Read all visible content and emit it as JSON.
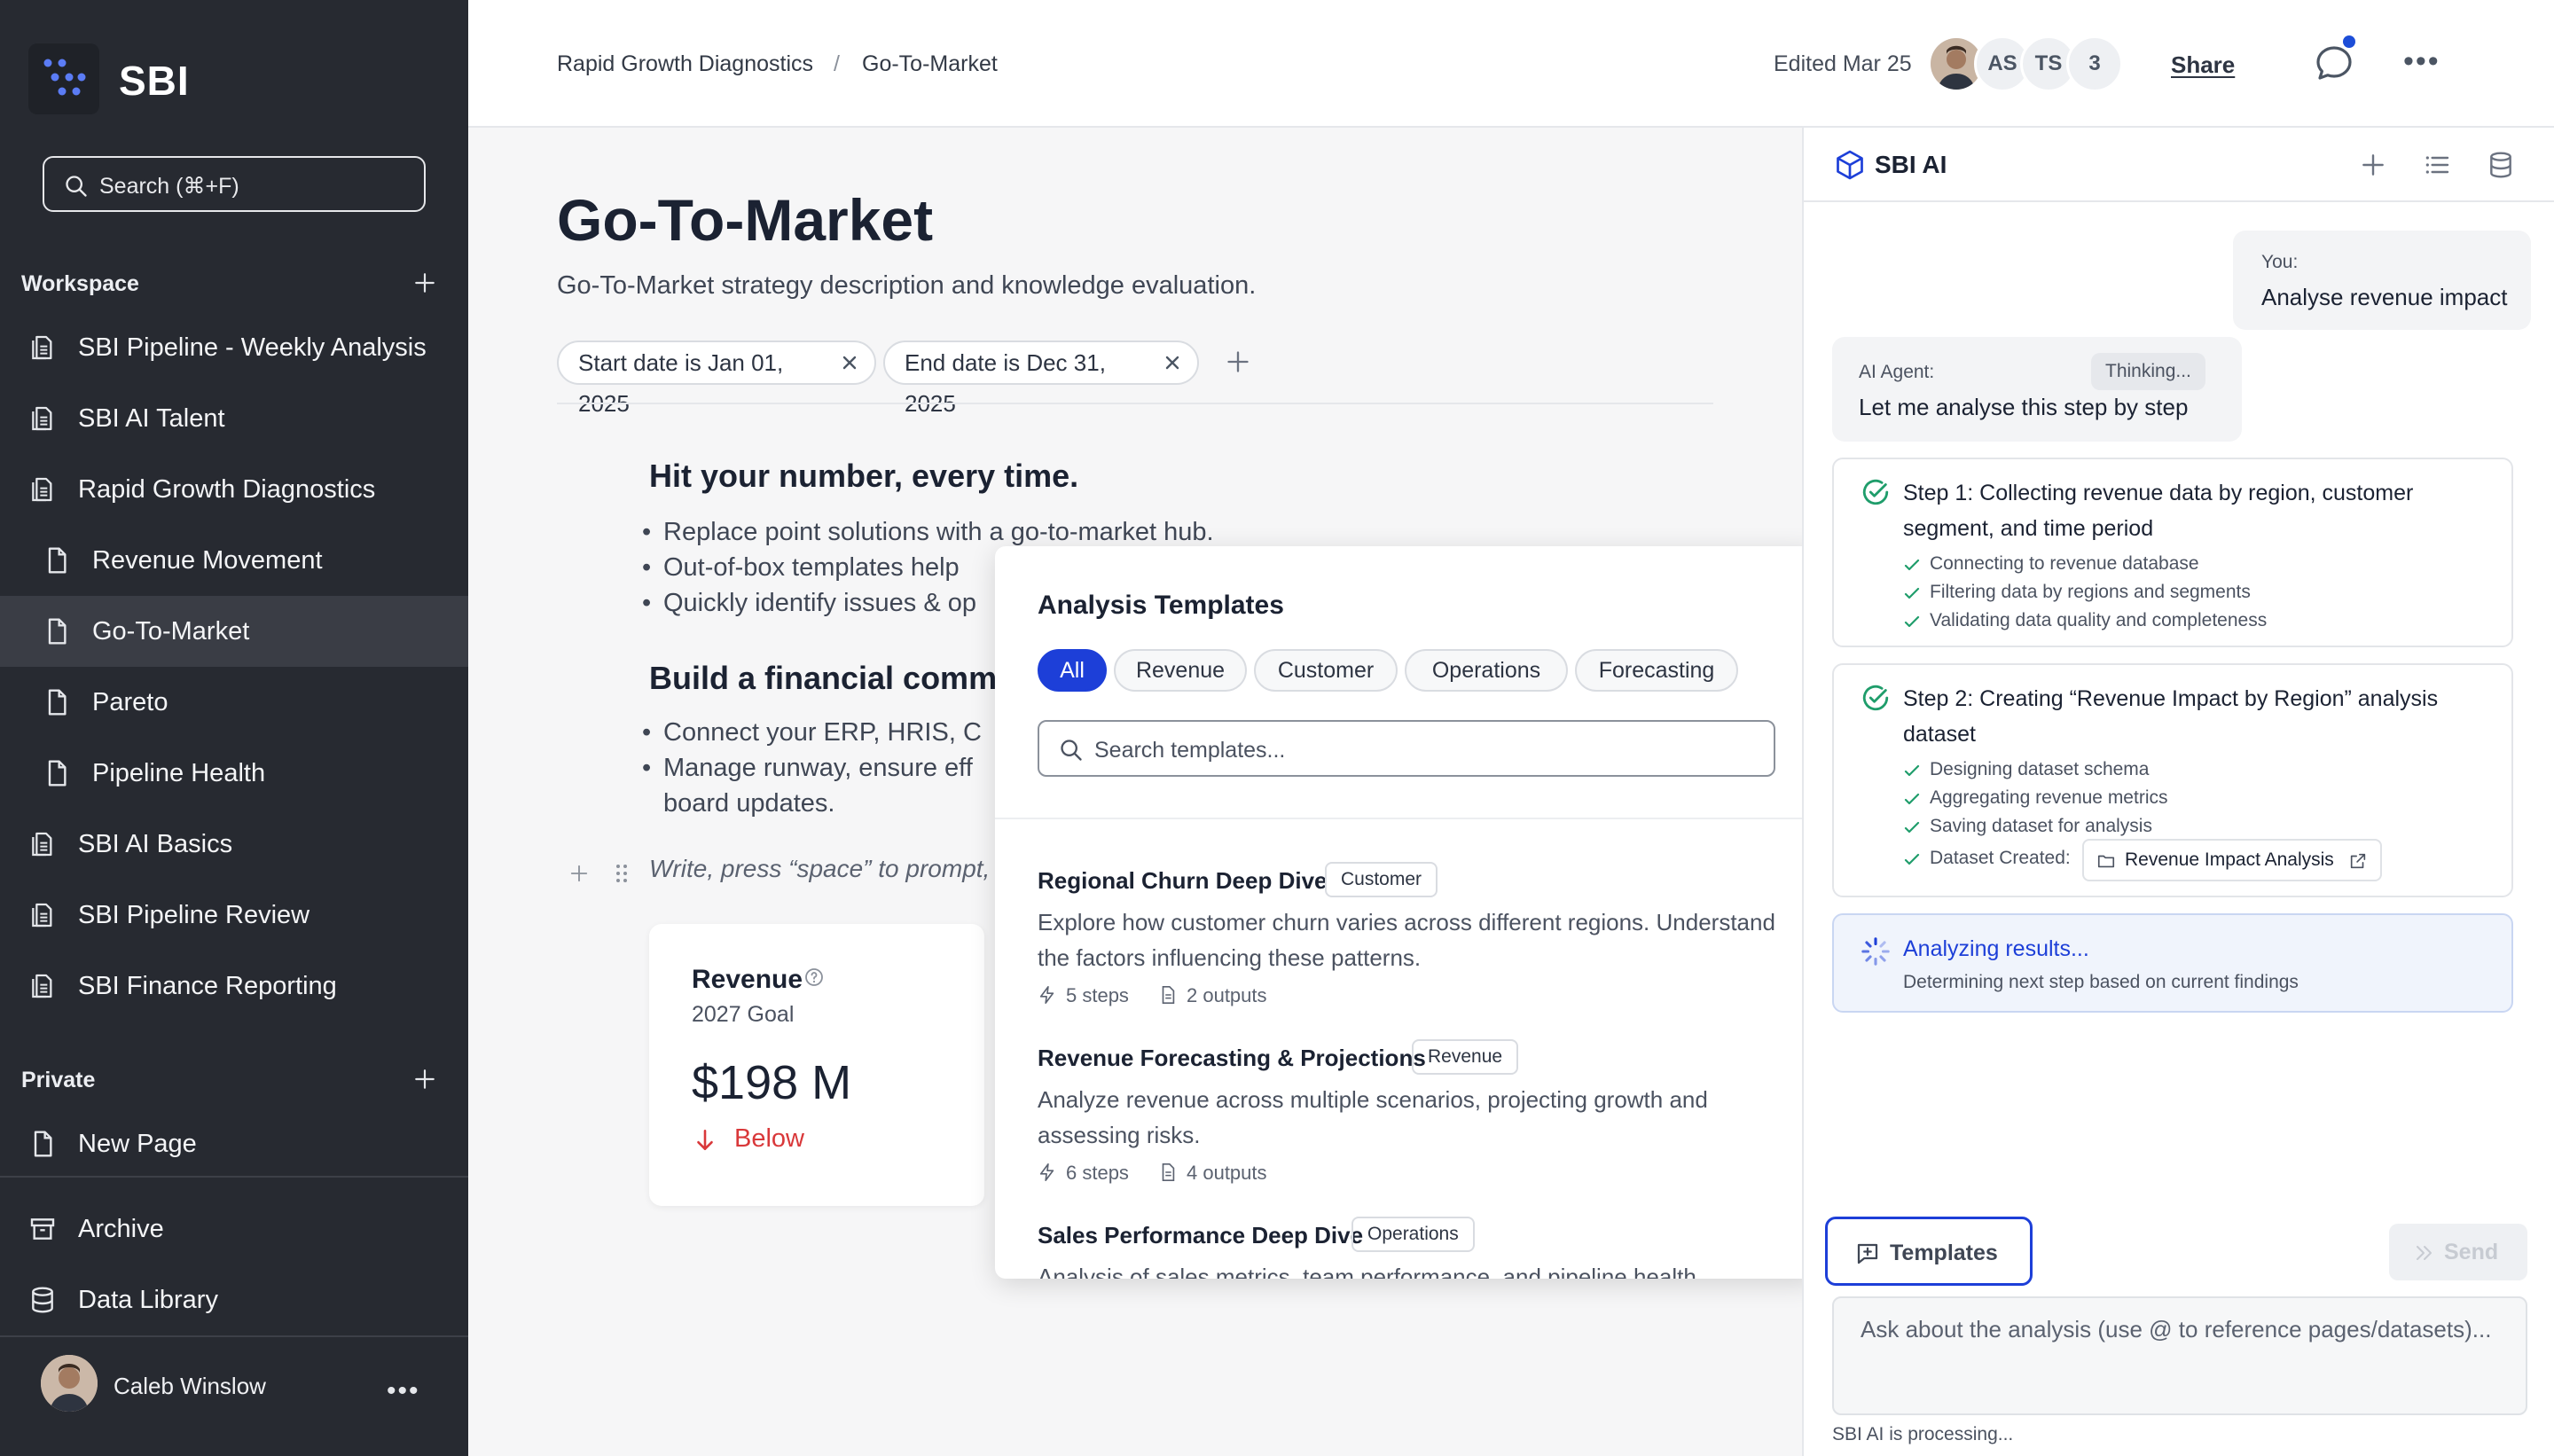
{
  "sidebar": {
    "brand": "SBI",
    "search_label": "Search (⌘+F)",
    "workspace_title": "Workspace",
    "workspace_items": [
      {
        "label": "SBI Pipeline - Weekly Analysis",
        "icon": "pages-icon"
      },
      {
        "label": "SBI AI Talent",
        "icon": "pages-icon"
      },
      {
        "label": "Rapid Growth Diagnostics",
        "icon": "pages-icon"
      },
      {
        "label": "Revenue Movement",
        "icon": "page-icon"
      },
      {
        "label": "Go-To-Market",
        "icon": "page-icon",
        "active": true
      },
      {
        "label": "Pareto",
        "icon": "page-icon"
      },
      {
        "label": "Pipeline Health",
        "icon": "page-icon"
      },
      {
        "label": "SBI AI Basics",
        "icon": "pages-icon"
      },
      {
        "label": "SBI Pipeline Review",
        "icon": "pages-icon"
      },
      {
        "label": "SBI Finance Reporting",
        "icon": "pages-icon"
      }
    ],
    "private_title": "Private",
    "private_items": [
      {
        "label": "New Page",
        "icon": "page-icon"
      }
    ],
    "archive_label": "Archive",
    "data_library_label": "Data Library",
    "user_name": "Caleb Winslow"
  },
  "topbar": {
    "breadcrumb": [
      "Rapid Growth Diagnostics",
      "/",
      "Go-To-Market"
    ],
    "edited": "Edited Mar 25",
    "avatars": [
      "AS",
      "TS",
      "3"
    ],
    "share_label": "Share"
  },
  "doc": {
    "title": "Go-To-Market",
    "subtitle": "Go-To-Market strategy description and knowledge evaluation.",
    "filters": [
      "Start date is Jan 01, 2025",
      "End date is Dec 31, 2025"
    ],
    "section1_heading": "Hit your number, every time.",
    "section1_bullets": [
      "Replace point solutions with a go-to-market hub.",
      "Out-of-box templates help",
      "Quickly identify issues & op"
    ],
    "section2_heading": "Build a financial comma",
    "section2_bullets": [
      "Connect your ERP, HRIS, C",
      "Manage runway, ensure eff",
      "board updates."
    ],
    "prompt_placeholder": "Write, press “space” to prompt, “",
    "kpi": {
      "title": "Revenue",
      "subtitle": "2027 Goal",
      "value": "$198 M",
      "status": "Below",
      "status_color": "#d9383a"
    }
  },
  "templates_popup": {
    "title": "Analysis Templates",
    "tabs": [
      "All",
      "Revenue",
      "Customer",
      "Operations",
      "Forecasting"
    ],
    "active_tab": "All",
    "search_placeholder": "Search templates...",
    "items": [
      {
        "title": "Regional Churn Deep Dive",
        "tag": "Customer",
        "description": "Explore how customer churn varies across different regions. Understand the factors influencing these patterns.",
        "steps": "5 steps",
        "outputs": "2 outputs"
      },
      {
        "title": "Revenue Forecasting & Projections",
        "tag": "Revenue",
        "description": "Analyze revenue across multiple scenarios, projecting growth and assessing risks.",
        "steps": "6 steps",
        "outputs": "4 outputs"
      },
      {
        "title": "Sales Performance Deep Dive",
        "tag": "Operations",
        "description": "Analysis of sales metrics, team performance, and pipeline health"
      }
    ]
  },
  "ai_panel": {
    "title": "SBI AI",
    "user_label": "You:",
    "user_message": "Analyse revenue impact",
    "agent_label": "AI Agent:",
    "agent_status": "Thinking...",
    "agent_message": "Let me analyse this step by step",
    "steps": [
      {
        "title": "Step 1: Collecting revenue data by region, customer segment, and time period",
        "subs": [
          "Connecting to revenue database",
          "Filtering data by regions and segments",
          "Validating data quality and completeness"
        ]
      },
      {
        "title": "Step 2: Creating “Revenue Impact by Region” analysis dataset",
        "subs": [
          "Designing dataset schema",
          "Aggregating revenue metrics",
          "Saving dataset for analysis"
        ],
        "dataset_label": "Dataset Created:",
        "dataset_name": "Revenue Impact Analysis"
      }
    ],
    "analyzing_title": "Analyzing results...",
    "analyzing_sub": "Determining next step based on current findings",
    "templates_button": "Templates",
    "send_button": "Send",
    "input_placeholder": "Ask about the analysis (use @ to reference pages/datasets)...",
    "processing": "SBI AI is processing...",
    "accent_color": "#1d3fd8"
  }
}
